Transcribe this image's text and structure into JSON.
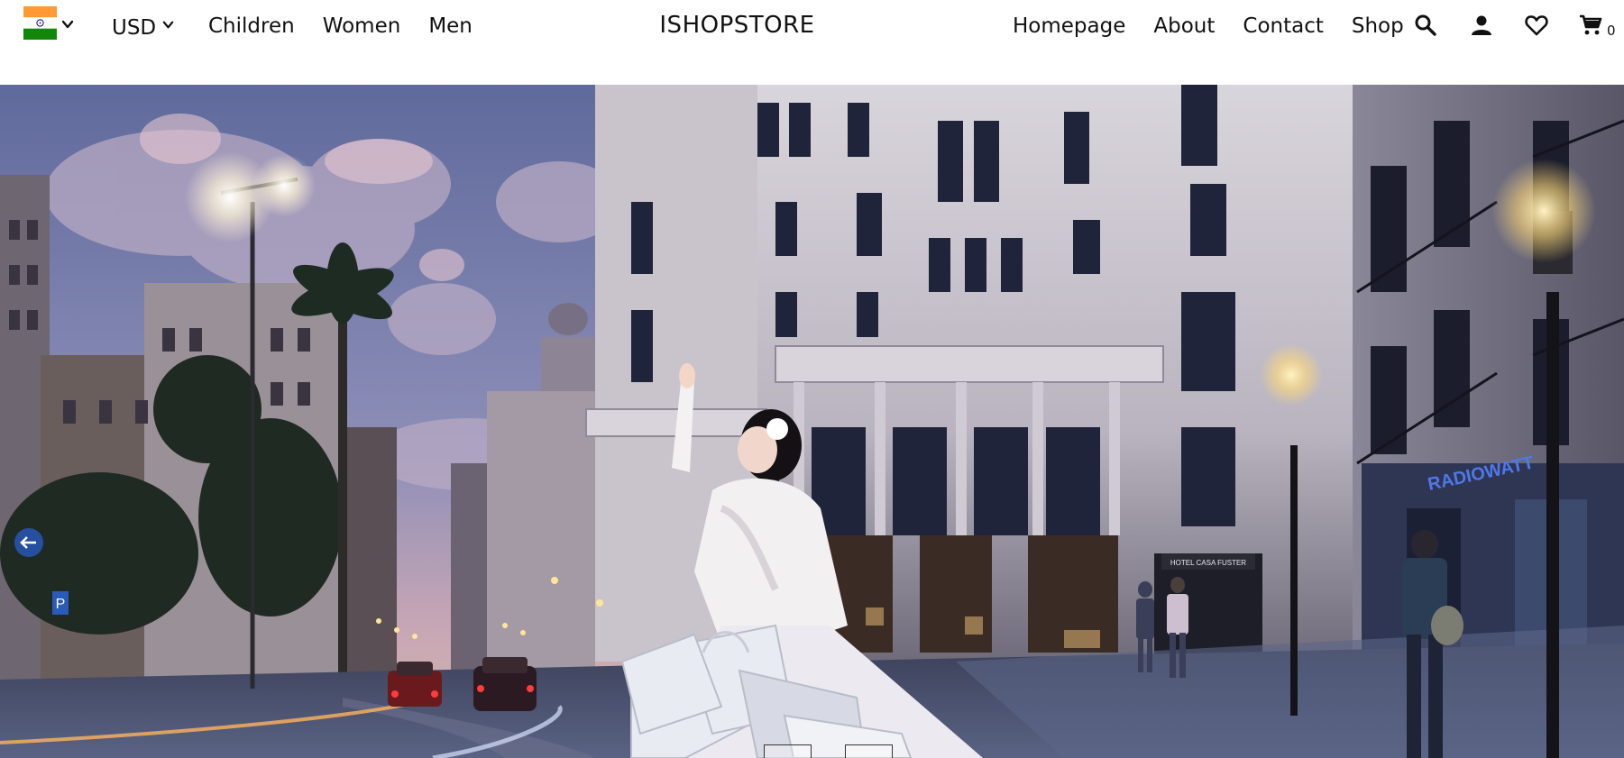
{
  "header": {
    "flag_icon": "india-flag-icon",
    "currency": "USD",
    "nav_left": [
      "Children",
      "Women",
      "Men"
    ],
    "brand": "ISHOPSTORE",
    "nav_right": [
      "Homepage",
      "About",
      "Contact",
      "Shop"
    ],
    "icons": [
      "search-icon",
      "user-icon",
      "heart-icon",
      "cart-icon"
    ],
    "cart_count": "0"
  },
  "hero": {
    "prev_icon": "arrow-left-icon",
    "next_icon": "arrow-right-icon",
    "sign_parking": "P",
    "hotel_sign": "HOTEL CASA FUSTER",
    "shop_sign": "RADIOWATT"
  },
  "colors": {
    "flag_saffron": "#FF9933",
    "flag_green": "#138808",
    "flag_chakra": "#000080",
    "sky": "#8b8fb8",
    "building": "#c7c2c9",
    "street": "#4d5470"
  }
}
